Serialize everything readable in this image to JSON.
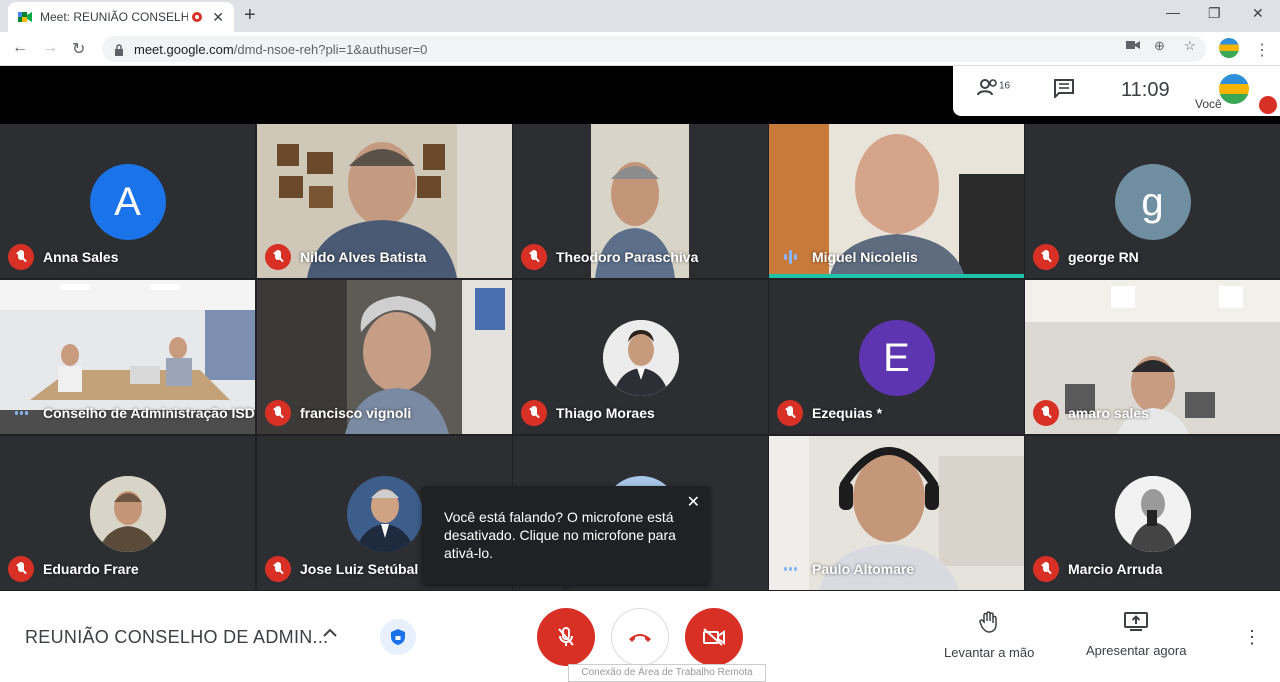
{
  "browser": {
    "tab_title": "Meet: REUNIÃO CONSELHO",
    "tab_close": "✕",
    "new_tab": "+",
    "url_host": "meet.google.com",
    "url_rest": "/dmd-nsoe-reh?pli=1&authuser=0",
    "window_minimize": "—",
    "window_restore": "❐",
    "window_close": "✕"
  },
  "info": {
    "people_count": "16",
    "time": "11:09",
    "self_label": "Você"
  },
  "tiles": [
    {
      "name": "Anna Sales",
      "status": "muted",
      "initial": "A",
      "avatar_color": "#1a73e8"
    },
    {
      "name": "Nildo Alves Batista",
      "status": "muted"
    },
    {
      "name": "Theodoro Paraschiva",
      "status": "muted"
    },
    {
      "name": "Miguel Nicolelis",
      "status": "speaking"
    },
    {
      "name": "george RN",
      "status": "muted",
      "initial": "g",
      "avatar_color": "#6f8fa0"
    },
    {
      "name": "Conselho de Administração ISD",
      "status": "active"
    },
    {
      "name": "francisco vignoli",
      "status": "muted"
    },
    {
      "name": "Thiago Moraes",
      "status": "muted"
    },
    {
      "name": "Ezequias *",
      "status": "muted",
      "initial": "E",
      "avatar_color": "#5e35b1"
    },
    {
      "name": "amaro sales",
      "status": "muted"
    },
    {
      "name": "Eduardo Frare",
      "status": "muted"
    },
    {
      "name": "Jose Luiz Setúbal",
      "status": "muted"
    },
    {
      "name": "",
      "status": "none"
    },
    {
      "name": "Paulo Altomare",
      "status": "active"
    },
    {
      "name": "Marcio Arruda",
      "status": "muted"
    }
  ],
  "toast": {
    "message": "Você está falando? O microfone está desativado. Clique no microfone para ativá-lo.",
    "close": "✕"
  },
  "bottom": {
    "meeting_title": "REUNIÃO CONSELHO DE ADMIN...",
    "raise_hand": "Levantar a mão",
    "present_now": "Apresentar agora",
    "remote_tooltip": "Conexão de Área de Trabalho Remota"
  },
  "colors": {
    "mute_red": "#d93025",
    "speaking_accent": "#1cc3a8"
  }
}
